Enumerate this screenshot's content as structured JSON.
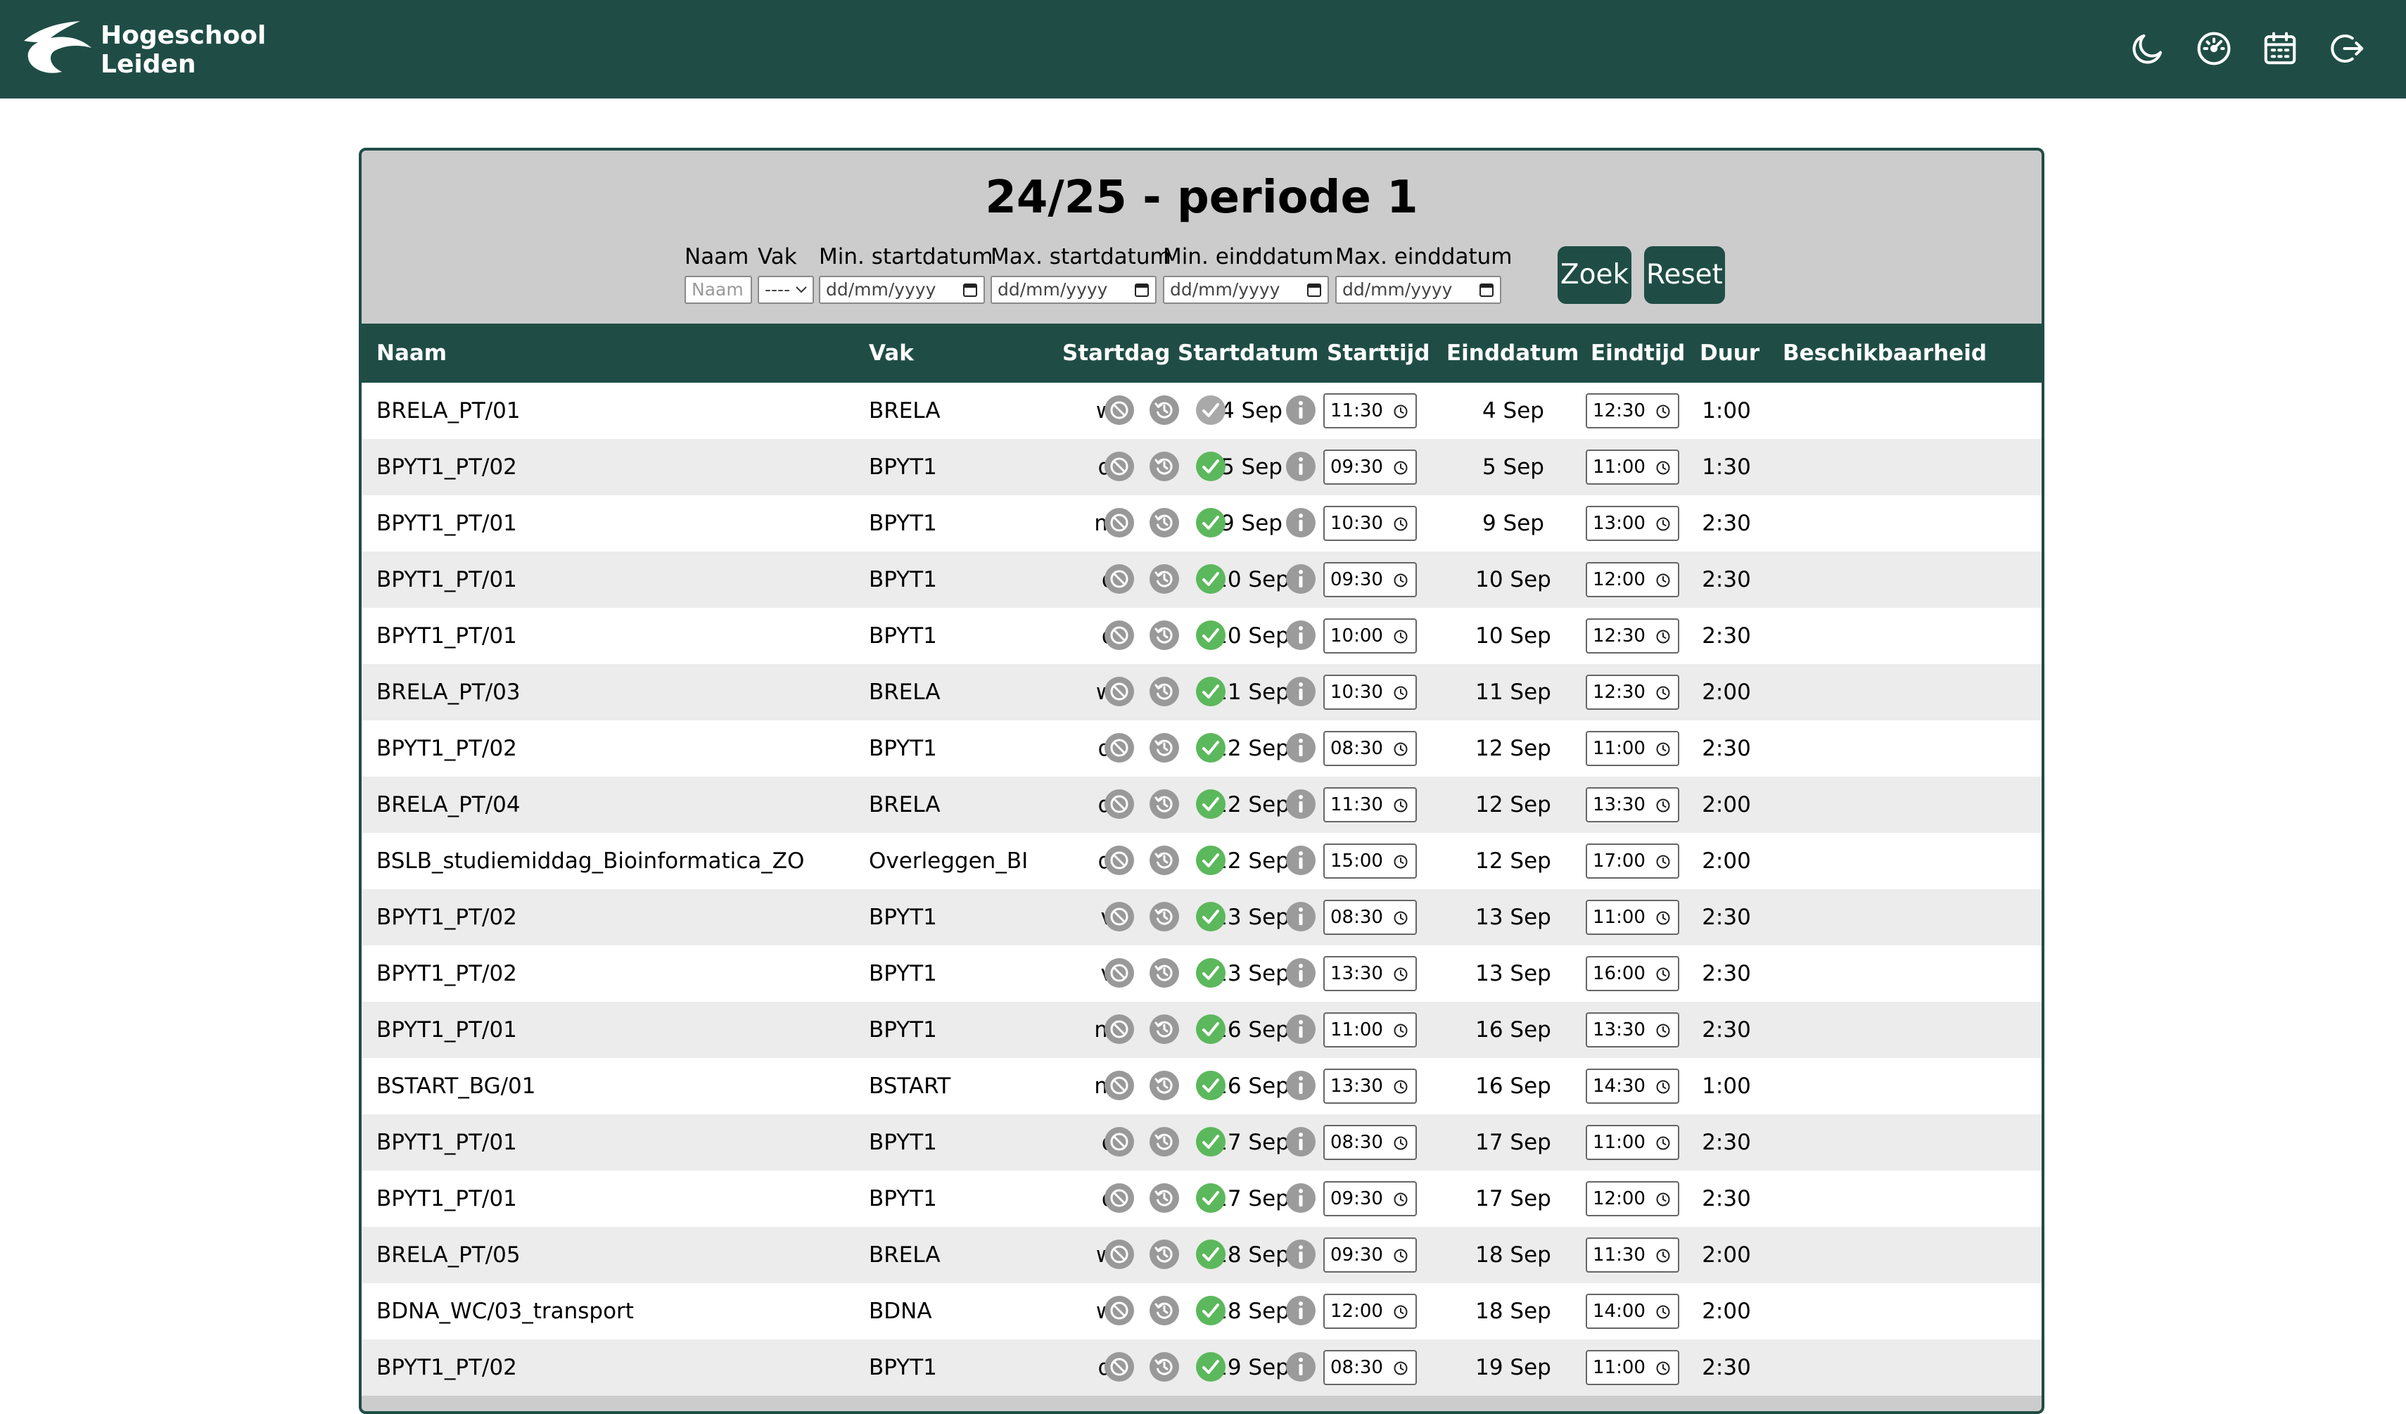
{
  "header": {
    "brand_line1": "Hogeschool",
    "brand_line2": "Leiden",
    "brand_color": "#1f4d45",
    "icons": [
      "moon-icon",
      "dashboard-icon",
      "calendar-icon",
      "logout-icon"
    ]
  },
  "page": {
    "title": "24/25 - periode 1"
  },
  "filters": {
    "naam_label": "Naam",
    "naam_placeholder": "Naam",
    "vak_label": "Vak",
    "vak_value": "----",
    "min_start_label": "Min. startdatum",
    "min_start_value": "dd/mm/yyyy",
    "max_start_label": "Max. startdatum",
    "max_start_value": "dd/mm/yyyy",
    "min_end_label": "Min. einddatum",
    "min_end_value": "dd/mm/yyyy",
    "max_end_label": "Max. einddatum",
    "max_end_value": "dd/mm/yyyy",
    "search_label": "Zoek",
    "reset_label": "Reset"
  },
  "table": {
    "headers": {
      "naam": "Naam",
      "vak": "Vak",
      "startdag": "Startdag",
      "startdatum": "Startdatum",
      "starttijd": "Starttijd",
      "einddatum": "Einddatum",
      "eindtijd": "Eindtijd",
      "duur": "Duur",
      "beschikbaarheid": "Beschikbaarheid"
    },
    "status_colors": {
      "available": "#5cb85c",
      "unavailable": "#999999"
    },
    "rows": [
      {
        "naam": "BRELA_PT/01",
        "vak": "BRELA",
        "startdag": "wo",
        "startdatum": "4 Sep",
        "starttijd": "11:30",
        "einddatum": "4 Sep",
        "eindtijd": "12:30",
        "duur": "1:00",
        "available": false
      },
      {
        "naam": "BPYT1_PT/02",
        "vak": "BPYT1",
        "startdag": "do",
        "startdatum": "5 Sep",
        "starttijd": "09:30",
        "einddatum": "5 Sep",
        "eindtijd": "11:00",
        "duur": "1:30",
        "available": true
      },
      {
        "naam": "BPYT1_PT/01",
        "vak": "BPYT1",
        "startdag": "ma",
        "startdatum": "9 Sep",
        "starttijd": "10:30",
        "einddatum": "9 Sep",
        "eindtijd": "13:00",
        "duur": "2:30",
        "available": true
      },
      {
        "naam": "BPYT1_PT/01",
        "vak": "BPYT1",
        "startdag": "di",
        "startdatum": "10 Sep",
        "starttijd": "09:30",
        "einddatum": "10 Sep",
        "eindtijd": "12:00",
        "duur": "2:30",
        "available": true
      },
      {
        "naam": "BPYT1_PT/01",
        "vak": "BPYT1",
        "startdag": "di",
        "startdatum": "10 Sep",
        "starttijd": "10:00",
        "einddatum": "10 Sep",
        "eindtijd": "12:30",
        "duur": "2:30",
        "available": true
      },
      {
        "naam": "BRELA_PT/03",
        "vak": "BRELA",
        "startdag": "wo",
        "startdatum": "11 Sep",
        "starttijd": "10:30",
        "einddatum": "11 Sep",
        "eindtijd": "12:30",
        "duur": "2:00",
        "available": true
      },
      {
        "naam": "BPYT1_PT/02",
        "vak": "BPYT1",
        "startdag": "do",
        "startdatum": "12 Sep",
        "starttijd": "08:30",
        "einddatum": "12 Sep",
        "eindtijd": "11:00",
        "duur": "2:30",
        "available": true
      },
      {
        "naam": "BRELA_PT/04",
        "vak": "BRELA",
        "startdag": "do",
        "startdatum": "12 Sep",
        "starttijd": "11:30",
        "einddatum": "12 Sep",
        "eindtijd": "13:30",
        "duur": "2:00",
        "available": true
      },
      {
        "naam": "BSLB_studiemiddag_Bioinformatica_ZO",
        "vak": "Overleggen_BI",
        "startdag": "do",
        "startdatum": "12 Sep",
        "starttijd": "15:00",
        "einddatum": "12 Sep",
        "eindtijd": "17:00",
        "duur": "2:00",
        "available": true
      },
      {
        "naam": "BPYT1_PT/02",
        "vak": "BPYT1",
        "startdag": "vr",
        "startdatum": "13 Sep",
        "starttijd": "08:30",
        "einddatum": "13 Sep",
        "eindtijd": "11:00",
        "duur": "2:30",
        "available": true
      },
      {
        "naam": "BPYT1_PT/02",
        "vak": "BPYT1",
        "startdag": "vr",
        "startdatum": "13 Sep",
        "starttijd": "13:30",
        "einddatum": "13 Sep",
        "eindtijd": "16:00",
        "duur": "2:30",
        "available": true
      },
      {
        "naam": "BPYT1_PT/01",
        "vak": "BPYT1",
        "startdag": "ma",
        "startdatum": "16 Sep",
        "starttijd": "11:00",
        "einddatum": "16 Sep",
        "eindtijd": "13:30",
        "duur": "2:30",
        "available": true
      },
      {
        "naam": "BSTART_BG/01",
        "vak": "BSTART",
        "startdag": "ma",
        "startdatum": "16 Sep",
        "starttijd": "13:30",
        "einddatum": "16 Sep",
        "eindtijd": "14:30",
        "duur": "1:00",
        "available": true
      },
      {
        "naam": "BPYT1_PT/01",
        "vak": "BPYT1",
        "startdag": "di",
        "startdatum": "17 Sep",
        "starttijd": "08:30",
        "einddatum": "17 Sep",
        "eindtijd": "11:00",
        "duur": "2:30",
        "available": true
      },
      {
        "naam": "BPYT1_PT/01",
        "vak": "BPYT1",
        "startdag": "di",
        "startdatum": "17 Sep",
        "starttijd": "09:30",
        "einddatum": "17 Sep",
        "eindtijd": "12:00",
        "duur": "2:30",
        "available": true
      },
      {
        "naam": "BRELA_PT/05",
        "vak": "BRELA",
        "startdag": "wo",
        "startdatum": "18 Sep",
        "starttijd": "09:30",
        "einddatum": "18 Sep",
        "eindtijd": "11:30",
        "duur": "2:00",
        "available": true
      },
      {
        "naam": "BDNA_WC/03_transport",
        "vak": "BDNA",
        "startdag": "wo",
        "startdatum": "18 Sep",
        "starttijd": "12:00",
        "einddatum": "18 Sep",
        "eindtijd": "14:00",
        "duur": "2:00",
        "available": true
      },
      {
        "naam": "BPYT1_PT/02",
        "vak": "BPYT1",
        "startdag": "do",
        "startdatum": "19 Sep",
        "starttijd": "08:30",
        "einddatum": "19 Sep",
        "eindtijd": "11:00",
        "duur": "2:30",
        "available": true
      }
    ]
  }
}
